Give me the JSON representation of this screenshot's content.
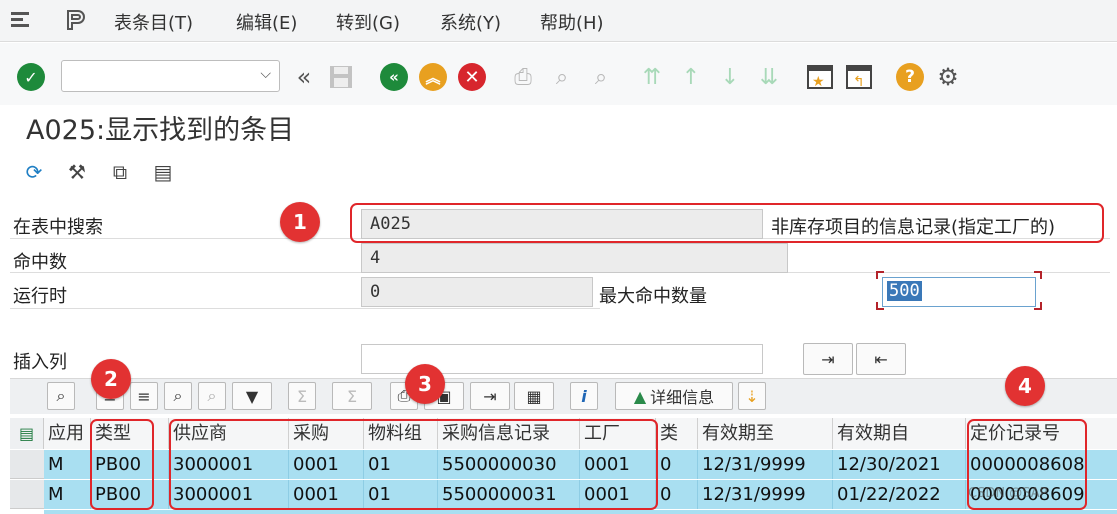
{
  "menu": {
    "items": [
      "表条目(T)",
      "编辑(E)",
      "转到(G)",
      "系统(Y)",
      "帮助(H)"
    ]
  },
  "toolbar": {
    "command_field": ""
  },
  "page": {
    "title": "A025:显示找到的条目"
  },
  "form": {
    "search_label": "在表中搜索",
    "search_value": "A025",
    "search_desc": "非库存项目的信息记录(指定工厂的)",
    "hits_label": "命中数",
    "hits_value": "4",
    "runtime_label": "运行时",
    "runtime_value": "0",
    "max_hits_label": "最大命中数量",
    "max_hits_value": "500",
    "insert_col_label": "插入列",
    "insert_col_value": ""
  },
  "grid_toolbar": {
    "detail_label": "详细信息"
  },
  "table": {
    "columns": [
      "应用",
      "类型",
      "供应商",
      "采购",
      "物料组",
      "采购信息记录",
      "工厂",
      "类",
      "有效期至",
      "有效期自",
      "定价记录号"
    ],
    "rows": [
      [
        "M",
        "PB00",
        "3000001",
        "0001",
        "01",
        "5500000030",
        "0001",
        "0",
        "12/31/9999",
        "12/30/2021",
        "0000008608"
      ],
      [
        "M",
        "PB00",
        "3000001",
        "0001",
        "01",
        "5500000031",
        "0001",
        "0",
        "12/31/9999",
        "01/22/2022",
        "0000008609"
      ]
    ]
  },
  "annotations": [
    "1",
    "2",
    "3",
    "4"
  ],
  "watermark": "CSDN @SAP"
}
